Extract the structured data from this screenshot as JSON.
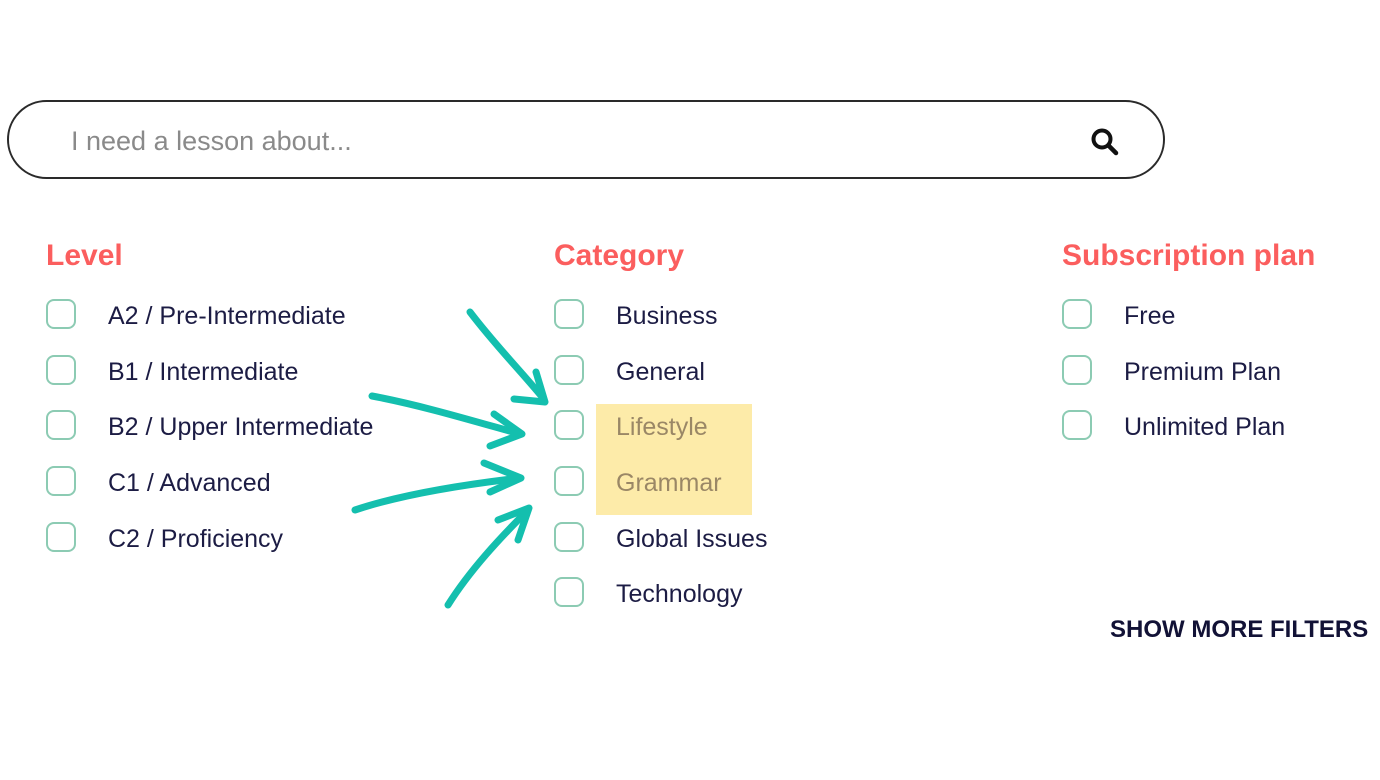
{
  "search": {
    "placeholder": "I need a lesson about...",
    "value": "",
    "icon": "search-icon"
  },
  "filters": {
    "level": {
      "title": "Level",
      "options": [
        {
          "label": "A2 / Pre-Intermediate",
          "checked": false
        },
        {
          "label": "B1 / Intermediate",
          "checked": false
        },
        {
          "label": "B2 / Upper Intermediate",
          "checked": false
        },
        {
          "label": "C1 / Advanced",
          "checked": false
        },
        {
          "label": "C2 / Proficiency",
          "checked": false
        }
      ]
    },
    "category": {
      "title": "Category",
      "options": [
        {
          "label": "Business",
          "checked": false
        },
        {
          "label": "General",
          "checked": false
        },
        {
          "label": "Lifestyle",
          "checked": false,
          "highlighted": true
        },
        {
          "label": "Grammar",
          "checked": false,
          "highlighted": true
        },
        {
          "label": "Global Issues",
          "checked": false
        },
        {
          "label": "Technology",
          "checked": false
        }
      ]
    },
    "subscription": {
      "title": "Subscription plan",
      "options": [
        {
          "label": "Free",
          "checked": false
        },
        {
          "label": "Premium Plan",
          "checked": false
        },
        {
          "label": "Unlimited Plan",
          "checked": false
        }
      ]
    }
  },
  "show_more_label": "SHOW MORE FILTERS",
  "colors": {
    "heading": "#fb5e5e",
    "checkbox_border": "#8ccbb3",
    "annotation_arrow": "#14bfae",
    "highlight": "#fdeba9"
  },
  "annotations": {
    "arrow_count": 4,
    "highlighted_items": [
      "Lifestyle",
      "Grammar"
    ]
  }
}
